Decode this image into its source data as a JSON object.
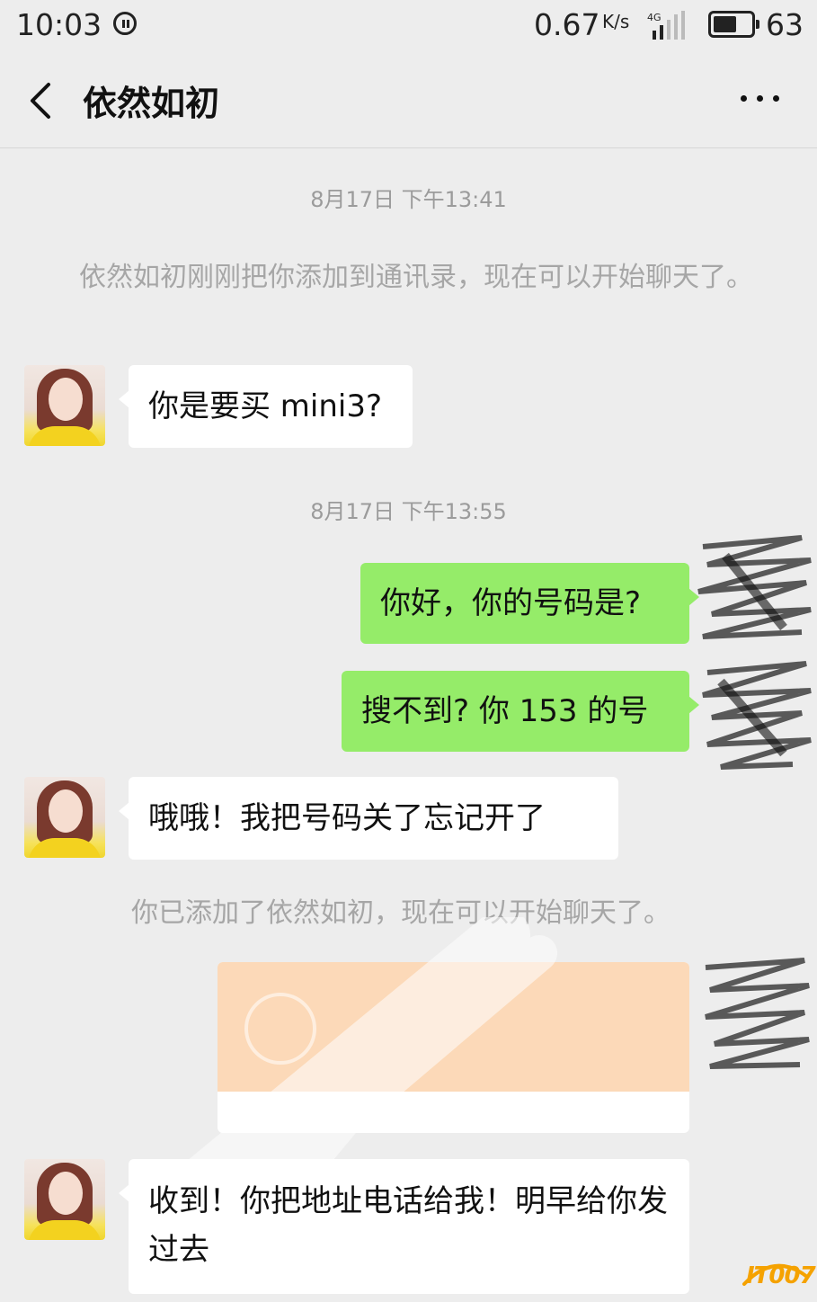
{
  "status_bar": {
    "time": "10:03",
    "speed": "0.67",
    "speed_unit": "K/s",
    "network": "4G",
    "battery_level": "63",
    "battery_fill": 0.63
  },
  "header": {
    "title": "依然如初",
    "back_icon": "chevron-left-icon",
    "more_icon": "more-dots-icon"
  },
  "messages": {
    "ts1": "8月17日 下午13:41",
    "system1": "依然如初刚刚把你添加到通讯录，现在可以开始聊天了。",
    "m1": "你是要买 mini3?",
    "ts2": "8月17日 下午13:55",
    "m2": "你好，你的号码是?",
    "m3": "搜不到? 你 153 的号",
    "m4": "哦哦！我把号码关了忘记开了",
    "system2": "你已添加了依然如初，现在可以开始聊天了。",
    "m6": "收到！你把地址电话给我！明早给你发过去"
  },
  "watermark": {
    "text": "IT007"
  },
  "colors": {
    "background": "#ededed",
    "incoming_bubble": "#ffffff",
    "outgoing_bubble": "#95ec69",
    "card_accent": "#fcd9b8",
    "watermark": "#f5a200"
  }
}
